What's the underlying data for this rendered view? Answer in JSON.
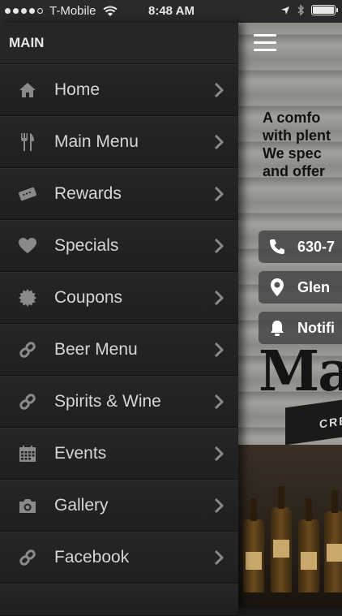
{
  "status_bar": {
    "carrier": "T-Mobile",
    "time": "8:48 AM",
    "signal_dots_filled": 4,
    "signal_dots_total": 5
  },
  "sidebar": {
    "section_title": "MAIN",
    "items": [
      {
        "label": "Home",
        "icon": "home-icon"
      },
      {
        "label": "Main Menu",
        "icon": "fork-knife-icon"
      },
      {
        "label": "Rewards",
        "icon": "ticket-icon"
      },
      {
        "label": "Specials",
        "icon": "heart-icon"
      },
      {
        "label": "Coupons",
        "icon": "seal-icon"
      },
      {
        "label": "Beer Menu",
        "icon": "link-icon"
      },
      {
        "label": "Spirits & Wine",
        "icon": "link-icon"
      },
      {
        "label": "Events",
        "icon": "calendar-icon"
      },
      {
        "label": "Gallery",
        "icon": "camera-icon"
      },
      {
        "label": "Facebook",
        "icon": "link-icon"
      }
    ]
  },
  "content": {
    "tagline_lines": [
      "A comfo",
      "with plent",
      "We spec",
      "and offer"
    ],
    "phone_text": "630-7",
    "location_text": "Glen",
    "notify_text": "Notifi",
    "brand_text": "Ma",
    "banner_text": "CRE"
  },
  "colors": {
    "sidebar_bg": "#222222",
    "label_text": "#d6d6d6",
    "icon": "#8a8a8a"
  }
}
